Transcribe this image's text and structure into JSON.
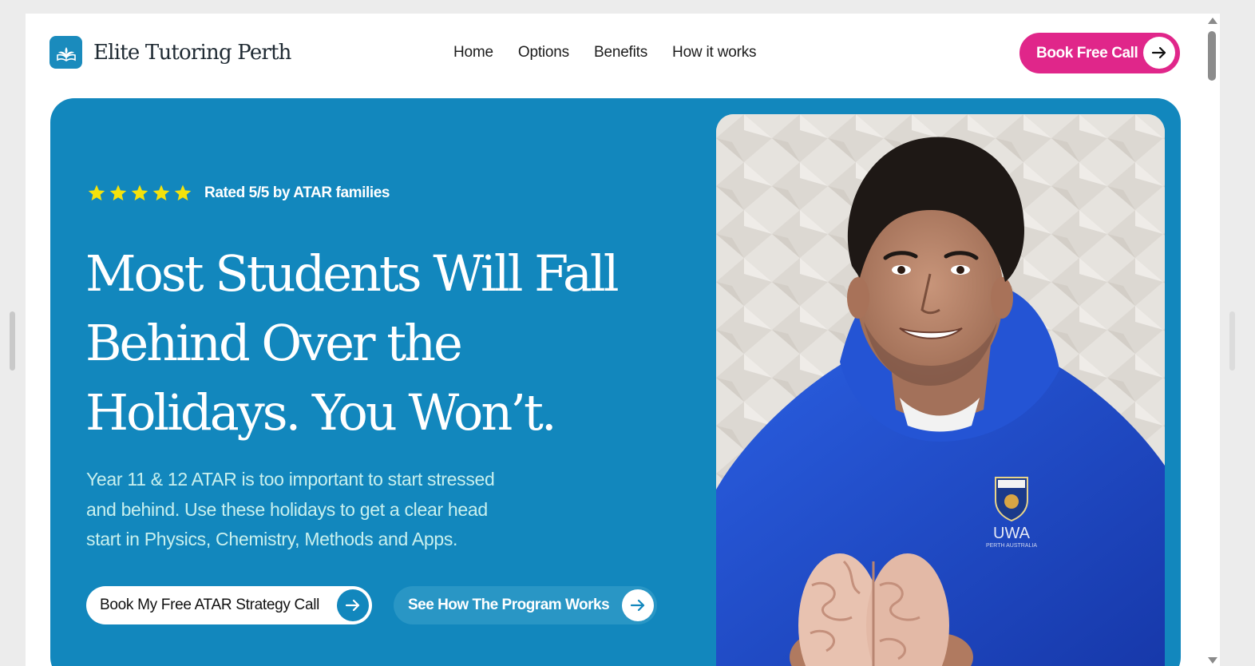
{
  "brand": {
    "name": "Elite Tutoring Perth",
    "logo_icon": "open-book-lotus-icon",
    "accent_color": "#1287bd",
    "cta_color": "#e0268a"
  },
  "nav": {
    "items": [
      {
        "label": "Home"
      },
      {
        "label": "Options"
      },
      {
        "label": "Benefits"
      },
      {
        "label": "How it works"
      }
    ]
  },
  "header_cta": {
    "label": "Book Free Call",
    "icon": "arrow-right-icon"
  },
  "hero": {
    "rating": {
      "stars": 5,
      "text": "Rated 5/5 by ATAR families",
      "star_color": "#f4e20c"
    },
    "headline_lines": [
      "Most Students Will Fall",
      "Behind Over the",
      "Holidays. You Won’t."
    ],
    "subtext_lines": [
      "Year 11 & 12 ATAR is too important to start stressed",
      "and behind. Use these holidays to get a clear head",
      "start in Physics, Chemistry, Methods and Apps."
    ],
    "primary_cta": {
      "label": "Book My Free ATAR Strategy Call",
      "icon": "arrow-right-icon"
    },
    "secondary_cta": {
      "label": "See How The Program Works",
      "icon": "arrow-right-icon"
    },
    "photo": {
      "hoodie_color": "#1f4fd0",
      "crest_text": "UWA",
      "crest_subtext": "PERTH AUSTRALIA"
    }
  }
}
